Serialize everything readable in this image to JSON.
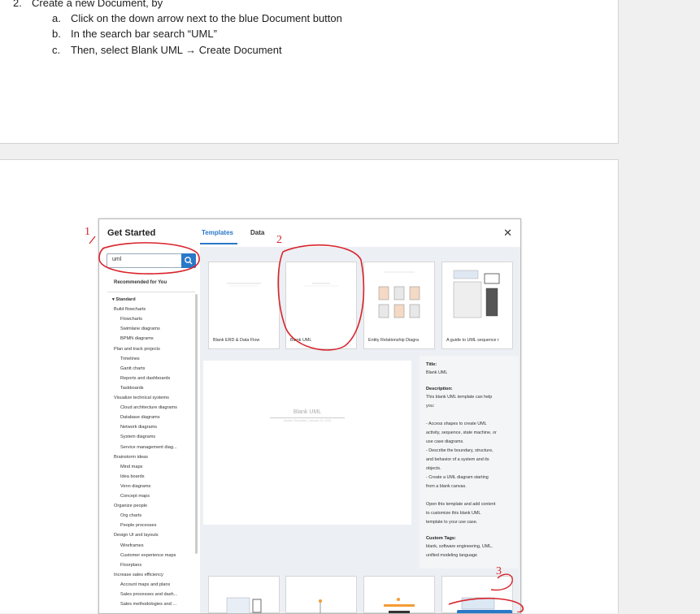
{
  "doc": {
    "step_number": "2.",
    "step_title": "Create a new Document, by",
    "items": [
      {
        "marker": "a.",
        "text": "Click on the down arrow next to the blue Document button"
      },
      {
        "marker": "b.",
        "text": "In the search bar search “UML”"
      },
      {
        "marker": "c.",
        "text": "Then, select Blank UML → Create Document"
      }
    ]
  },
  "dialog": {
    "title": "Get Started",
    "tabs": [
      "Templates",
      "Data"
    ],
    "close_icon": "close-icon",
    "search": {
      "value": "uml",
      "icon": "search-icon"
    },
    "sidebar_heading": "Recommended for You",
    "sidebar_items": [
      {
        "text": "▾ Standard",
        "level": 0
      },
      {
        "text": "Build flowcharts",
        "level": 1
      },
      {
        "text": "Flowcharts",
        "level": 2
      },
      {
        "text": "Swimlane diagrams",
        "level": 2
      },
      {
        "text": "BPMN diagrams",
        "level": 2
      },
      {
        "text": "Plan and track projects",
        "level": 1
      },
      {
        "text": "Timelines",
        "level": 2
      },
      {
        "text": "Gantt charts",
        "level": 2
      },
      {
        "text": "Reports and dashboards",
        "level": 2
      },
      {
        "text": "Taskboards",
        "level": 2
      },
      {
        "text": "Visualize technical systems",
        "level": 1
      },
      {
        "text": "Cloud architecture diagrams",
        "level": 2
      },
      {
        "text": "Database diagrams",
        "level": 2
      },
      {
        "text": "Network diagrams",
        "level": 2
      },
      {
        "text": "System diagrams",
        "level": 2
      },
      {
        "text": "Service management diag...",
        "level": 2
      },
      {
        "text": "Brainstorm ideas",
        "level": 1
      },
      {
        "text": "Mind maps",
        "level": 2
      },
      {
        "text": "Idea boards",
        "level": 2
      },
      {
        "text": "Venn diagrams",
        "level": 2
      },
      {
        "text": "Concept maps",
        "level": 2
      },
      {
        "text": "Organize people",
        "level": 1
      },
      {
        "text": "Org charts",
        "level": 2
      },
      {
        "text": "People processes",
        "level": 2
      },
      {
        "text": "Design UI and layouts",
        "level": 1
      },
      {
        "text": "Wireframes",
        "level": 2
      },
      {
        "text": "Customer experience maps",
        "level": 2
      },
      {
        "text": "Floorplans",
        "level": 2
      },
      {
        "text": "Increase sales efficiency",
        "level": 1
      },
      {
        "text": "Account maps and plans",
        "level": 2
      },
      {
        "text": "Sales processes and dash...",
        "level": 2
      },
      {
        "text": "Sales methodologies and ...",
        "level": 2
      }
    ],
    "templates": [
      {
        "label": "Blank ERD & Data Flow"
      },
      {
        "label": "Blank UML"
      },
      {
        "label": "Entity Relationship Diagra"
      },
      {
        "label": "A guide to UML sequence r"
      }
    ],
    "preview": {
      "title": "Blank UML",
      "subtitle": "System Templates | January 10, 2023"
    },
    "info": {
      "title_label": "Title:",
      "title_value": "Blank UML",
      "description_label": "Description:",
      "description_lines": [
        "This blank UML template can help",
        "you:",
        "",
        "- Access shapes to create UML",
        "activity, sequence, state machine, or",
        "use case diagrams.",
        "- Describe the boundary, structure,",
        "and behavior of a system and its",
        "objects.",
        "- Create a UML diagram starting",
        "from a blank canvas.",
        "",
        "Open this template and add content",
        "to customize this blank UML",
        "template to your use case."
      ],
      "tags_label": "Custom Tags:",
      "tags_lines": [
        "blank, software engineering, UML,",
        "unified modeling language"
      ]
    }
  },
  "annotations": {
    "numbers": [
      "1",
      "2",
      "3"
    ],
    "color": "#d9232b"
  },
  "colors": {
    "accent": "#2a78c8"
  }
}
